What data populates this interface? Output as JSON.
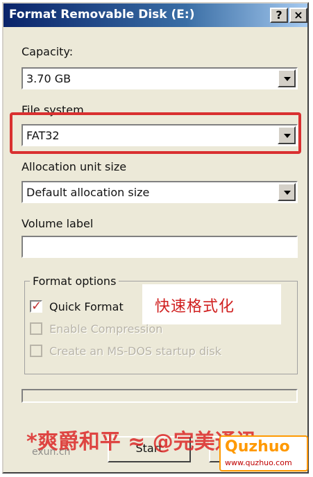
{
  "window": {
    "title": "Format Removable Disk (E:)",
    "help_label": "?",
    "close_label": "×"
  },
  "capacity": {
    "label": "Capacity:",
    "value": "3.70 GB"
  },
  "file_system": {
    "label": "File system",
    "value": "FAT32"
  },
  "allocation": {
    "label": "Allocation unit size",
    "value": "Default allocation size"
  },
  "volume": {
    "label": "Volume label",
    "value": ""
  },
  "format_options": {
    "title": "Format options",
    "quick_format": {
      "label": "Quick Format",
      "checked": true
    },
    "enable_compression": {
      "label": "Enable Compression",
      "checked": false,
      "disabled": true
    },
    "msdos_startup": {
      "label": "Create an MS-DOS startup disk",
      "checked": false,
      "disabled": true
    }
  },
  "annotation": {
    "text": "快速格式化"
  },
  "progress": {
    "value": 0
  },
  "buttons": {
    "start_label": "Start"
  },
  "watermark": {
    "text": "*爽爵和平 ≈ @完美通讯",
    "site": "exun.cn"
  },
  "logo": {
    "brand": "Quzhuo",
    "url": "www.quzhuo.com"
  },
  "colors": {
    "highlight": "#d93030",
    "titlebar": "#0a246a",
    "annotation": "#d02020"
  }
}
